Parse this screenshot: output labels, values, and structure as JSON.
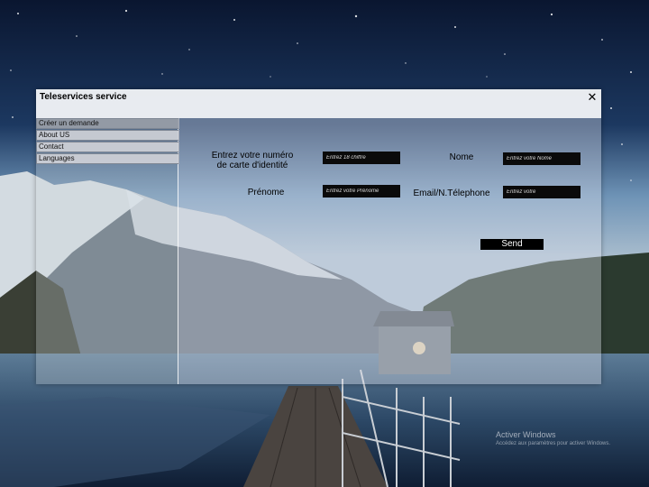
{
  "window": {
    "title": "Teleservices service",
    "close_glyph": "✕"
  },
  "sidebar": {
    "items": [
      {
        "label": "Créer un demande",
        "active": true
      },
      {
        "label": "About US",
        "active": false
      },
      {
        "label": "Contact",
        "active": false
      },
      {
        "label": "Languages",
        "active": false
      }
    ]
  },
  "form": {
    "card_label_line1": "Entrez votre numéro",
    "card_label_line2": "de carte d'identité",
    "card_placeholder": "Entrez 18 chiffre",
    "nom_label": "Nome",
    "nom_placeholder": "Entrez votre Nome",
    "prenom_label": "Prénome",
    "prenom_placeholder": "Entrez votre Prénome",
    "email_label": "Email/N.Télephone",
    "email_placeholder": "Entrez votre",
    "send_label": "Send"
  },
  "watermark": {
    "title": "Activer Windows",
    "subtitle": "Accédez aux paramètres pour activer Windows."
  },
  "colors": {
    "field_bg": "#0a0a0a",
    "menu_active": "#969ca6",
    "menu_bg": "#cdd0d6"
  }
}
